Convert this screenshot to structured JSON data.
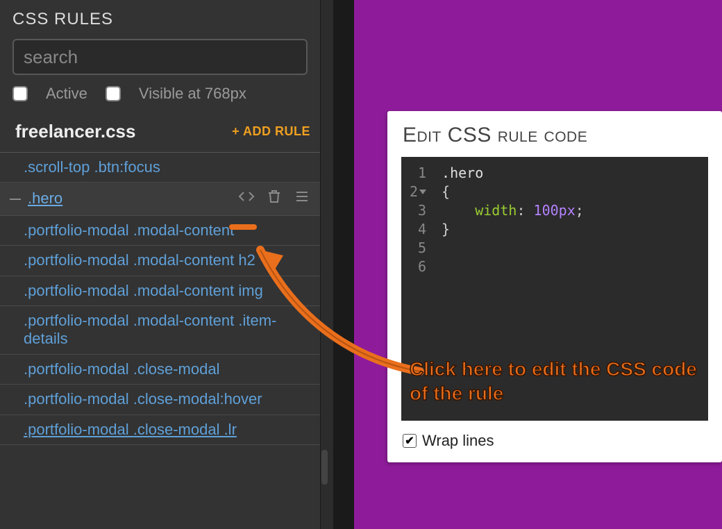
{
  "panel": {
    "title": "CSS RULES",
    "search_placeholder": "search",
    "filters": {
      "active": "Active",
      "visible": "Visible at 768px"
    },
    "file_name": "freelancer.css",
    "add_rule": "+ ADD RULE",
    "rules": [
      ".scroll-top .btn:focus",
      ".hero",
      ".portfolio-modal .modal-content",
      ".portfolio-modal .modal-content h2",
      ".portfolio-modal .modal-content img",
      ".portfolio-modal .modal-content .item-details",
      ".portfolio-modal .close-modal",
      ".portfolio-modal .close-modal:hover",
      ".portfolio-modal .close-modal .lr"
    ],
    "selected_index": 1
  },
  "editor": {
    "title": "Edit CSS rule code",
    "gutter": [
      "1",
      "2",
      "3",
      "4",
      "5",
      "6"
    ],
    "code": {
      "selector": ".hero",
      "open": "{",
      "prop": "width",
      "colon": ": ",
      "value": "100px",
      "semi": ";",
      "close": "}"
    },
    "wrap_label": "Wrap lines",
    "wrap_checked": true
  },
  "annotation": {
    "text": "Click here to edit the CSS code of the rule"
  },
  "colors": {
    "accent_orange": "#ea6f1c",
    "link_blue": "#5fa0d8",
    "purple_bg": "#8e1c9a"
  }
}
